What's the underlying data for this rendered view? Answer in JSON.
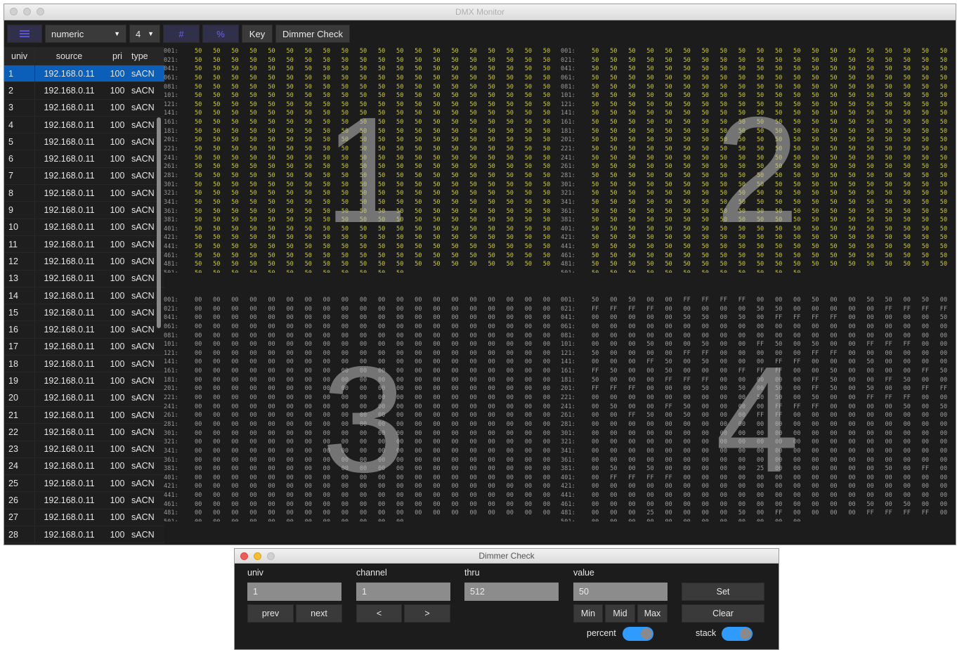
{
  "window": {
    "title": "DMX Monitor"
  },
  "toolbar": {
    "menu_icon": "list-icon",
    "display_mode": "numeric",
    "columns_value": "4",
    "hash_label": "#",
    "percent_label": "%",
    "key_label": "Key",
    "dimmer_check_label": "Dimmer Check"
  },
  "table": {
    "headers": {
      "univ": "univ",
      "source": "source",
      "pri": "pri",
      "type": "type"
    },
    "rows": [
      {
        "univ": "1",
        "source": "192.168.0.11",
        "pri": "100",
        "type": "sACN"
      },
      {
        "univ": "2",
        "source": "192.168.0.11",
        "pri": "100",
        "type": "sACN"
      },
      {
        "univ": "3",
        "source": "192.168.0.11",
        "pri": "100",
        "type": "sACN"
      },
      {
        "univ": "4",
        "source": "192.168.0.11",
        "pri": "100",
        "type": "sACN"
      },
      {
        "univ": "5",
        "source": "192.168.0.11",
        "pri": "100",
        "type": "sACN"
      },
      {
        "univ": "6",
        "source": "192.168.0.11",
        "pri": "100",
        "type": "sACN"
      },
      {
        "univ": "7",
        "source": "192.168.0.11",
        "pri": "100",
        "type": "sACN"
      },
      {
        "univ": "8",
        "source": "192.168.0.11",
        "pri": "100",
        "type": "sACN"
      },
      {
        "univ": "9",
        "source": "192.168.0.11",
        "pri": "100",
        "type": "sACN"
      },
      {
        "univ": "10",
        "source": "192.168.0.11",
        "pri": "100",
        "type": "sACN"
      },
      {
        "univ": "11",
        "source": "192.168.0.11",
        "pri": "100",
        "type": "sACN"
      },
      {
        "univ": "12",
        "source": "192.168.0.11",
        "pri": "100",
        "type": "sACN"
      },
      {
        "univ": "13",
        "source": "192.168.0.11",
        "pri": "100",
        "type": "sACN"
      },
      {
        "univ": "14",
        "source": "192.168.0.11",
        "pri": "100",
        "type": "sACN"
      },
      {
        "univ": "15",
        "source": "192.168.0.11",
        "pri": "100",
        "type": "sACN"
      },
      {
        "univ": "16",
        "source": "192.168.0.11",
        "pri": "100",
        "type": "sACN"
      },
      {
        "univ": "17",
        "source": "192.168.0.11",
        "pri": "100",
        "type": "sACN"
      },
      {
        "univ": "18",
        "source": "192.168.0.11",
        "pri": "100",
        "type": "sACN"
      },
      {
        "univ": "19",
        "source": "192.168.0.11",
        "pri": "100",
        "type": "sACN"
      },
      {
        "univ": "20",
        "source": "192.168.0.11",
        "pri": "100",
        "type": "sACN"
      },
      {
        "univ": "21",
        "source": "192.168.0.11",
        "pri": "100",
        "type": "sACN"
      },
      {
        "univ": "22",
        "source": "192.168.0.11",
        "pri": "100",
        "type": "sACN"
      },
      {
        "univ": "23",
        "source": "192.168.0.11",
        "pri": "100",
        "type": "sACN"
      },
      {
        "univ": "24",
        "source": "192.168.0.11",
        "pri": "100",
        "type": "sACN"
      },
      {
        "univ": "25",
        "source": "192.168.0.11",
        "pri": "100",
        "type": "sACN"
      },
      {
        "univ": "26",
        "source": "192.168.0.11",
        "pri": "100",
        "type": "sACN"
      },
      {
        "univ": "27",
        "source": "192.168.0.11",
        "pri": "100",
        "type": "sACN"
      },
      {
        "univ": "28",
        "source": "192.168.0.11",
        "pri": "100",
        "type": "sACN"
      }
    ]
  },
  "universe_grids": {
    "overlay_labels": [
      "1",
      "2",
      "3",
      "4"
    ],
    "row_labels": [
      "001:",
      "021:",
      "041:",
      "061:",
      "081:",
      "101:",
      "121:",
      "141:",
      "161:",
      "181:",
      "201:",
      "221:",
      "241:",
      "261:",
      "281:",
      "301:",
      "321:",
      "341:",
      "361:",
      "381:",
      "401:",
      "421:",
      "441:",
      "461:",
      "481:",
      "501:"
    ],
    "grid1_value": "50",
    "grid2_value": "50",
    "grid3_value": "00",
    "grid4_rows": [
      "50 00 50 00 00 FF FF FF FF 00 00 00 50 00 00 50 50 00 50 00",
      "FF FF FF FF 00 00 00 00 00 50 50 00 00 00 00 00 FF FF FF FF",
      "00 00 00 00 00 50 50 00 50 00 FF FF FF FF 00 00 00 00 00 50",
      "00 00 00 00 00 00 00 00 00 00 00 00 00 00 00 00 00 00 00 00",
      "00 00 00 00 00 00 00 00 00 00 00 00 00 00 00 00 00 00 00 00",
      "00 00 00 50 00 00 50 00 00 FF 50 00 50 00 00 FF FF FF 00 00",
      "50 00 00 00 00 FF FF 00 00 00 00 00 FF FF 00 00 00 00 00 00",
      "00 00 00 FF 50 00 50 00 00 00 FF FF 00 00 00 50 00 00 00 00",
      "FF 50 00 00 50 00 00 00 FF FF FF 00 00 50 00 00 00 00 FF 50",
      "50 00 00 00 FF FF FF 00 00 00 00 00 FF 50 00 00 FF 50 00 00",
      "FF FF FF 00 00 00 50 00 50 00 50 00 FF 50 00 50 00 00 FF FF",
      "00 00 00 00 00 00 00 00 00 50 50 00 50 00 00 FF FF FF 00 00",
      "00 50 00 00 FF 50 00 00 00 00 FF FF FF 00 00 00 00 50 00 50",
      "00 00 FF 50 00 50 00 00 00 FF FF 00 00 00 00 00 00 00 00 00",
      "00 00 00 00 00 00 00 00 00 00 00 00 00 00 00 00 00 00 00 00",
      "00 00 00 00 00 00 00 00 00 00 00 00 00 00 00 00 00 00 00 00",
      "00 00 00 00 00 00 00 00 00 00 00 00 00 00 00 00 00 00 00 00",
      "00 00 00 00 00 00 00 00 00 00 00 00 00 00 00 00 00 00 00 00",
      "00 00 00 00 00 00 00 00 00 00 00 00 00 00 00 00 00 00 00 00",
      "00 50 00 50 00 00 00 00 00 25 00 00 00 00 00 00 50 00 FF 00",
      "00 FF FF FF FF 00 00 00 00 00 00 00 00 00 00 00 00 00 00 00",
      "00 00 00 00 00 00 00 00 00 00 00 00 00 00 00 00 00 00 00 00",
      "00 00 00 00 00 00 00 00 00 00 00 00 00 00 00 00 00 00 00 00",
      "00 00 00 00 00 00 00 00 00 00 00 00 00 00 00 50 00 50 00 00",
      "00 00 00 25 00 00 00 00 50 00 FF 00 00 00 00 FF FF FF FF 00",
      "00 00 00 00 00 00 00 00 00 00 00 00"
    ]
  },
  "dimmer_check": {
    "title": "Dimmer Check",
    "labels": {
      "univ": "univ",
      "channel": "channel",
      "thru": "thru",
      "value": "value"
    },
    "fields": {
      "univ": "1",
      "channel": "1",
      "thru": "512",
      "value": "50"
    },
    "buttons": {
      "prev": "prev",
      "next": "next",
      "ch_prev": "<",
      "ch_next": ">",
      "min": "Min",
      "mid": "Mid",
      "max": "Max",
      "set": "Set",
      "clear": "Clear"
    },
    "toggles": {
      "percent": "percent",
      "stack": "stack"
    }
  },
  "colors": {
    "accent": "#0b5fb8",
    "value_yellow": "#c9c934",
    "value_gray": "#9b9b9b",
    "toggle_blue": "#2f9bff"
  }
}
